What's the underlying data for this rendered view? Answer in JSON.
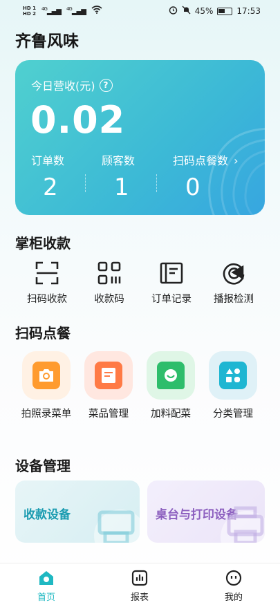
{
  "status_bar": {
    "sim1": "HD 1",
    "sim2": "HD 2",
    "network1": "4G",
    "network2": "4G",
    "battery_percent": "45%",
    "time": "17:53"
  },
  "app_title": "齐鲁风味",
  "revenue": {
    "label": "今日营收(元)",
    "amount": "0.02",
    "stats": [
      {
        "label": "订单数",
        "value": "2"
      },
      {
        "label": "顾客数",
        "value": "1"
      },
      {
        "label": "扫码点餐数",
        "value": "0",
        "chevron": "›"
      }
    ]
  },
  "cashier": {
    "title": "掌柜收款",
    "items": [
      {
        "label": "扫码收款",
        "icon": "scan-icon"
      },
      {
        "label": "收款码",
        "icon": "qrcode-icon"
      },
      {
        "label": "订单记录",
        "icon": "order-record-icon"
      },
      {
        "label": "播报检测",
        "icon": "broadcast-check-icon"
      }
    ]
  },
  "scan_order": {
    "title": "扫码点餐",
    "items": [
      {
        "label": "拍照录菜单",
        "icon": "camera-icon",
        "color": "#ff9b2f"
      },
      {
        "label": "菜品管理",
        "icon": "dish-doc-icon",
        "color": "#ff7a45"
      },
      {
        "label": "加料配菜",
        "icon": "bowl-icon",
        "color": "#2ebd6b"
      },
      {
        "label": "分类管理",
        "icon": "category-icon",
        "color": "#1fb6d2"
      }
    ]
  },
  "device": {
    "title": "设备管理",
    "cards": [
      {
        "label": "收款设备",
        "color": "#1a9bb0"
      },
      {
        "label": "桌台与打印设备",
        "color": "#8c5fbf"
      }
    ]
  },
  "tabbar": {
    "tabs": [
      {
        "label": "首页",
        "active": true
      },
      {
        "label": "报表",
        "active": false
      },
      {
        "label": "我的",
        "active": false
      }
    ],
    "active_color": "#1fb8c2"
  }
}
